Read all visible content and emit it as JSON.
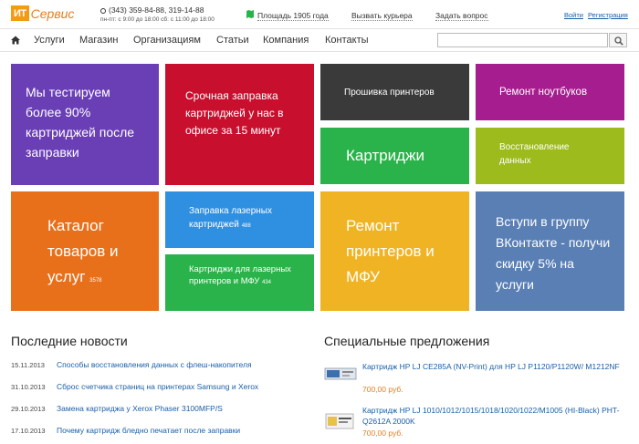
{
  "header": {
    "logo_box": "ИТ",
    "logo_text": "Сервис",
    "phone": "(343) 359-84-88, 319-14-88",
    "hours": "пн-пт: с 9:00 до 18:00   сб: с 11:00 до 18:00",
    "address": "Площадь 1905 года",
    "courier": "Вызвать курьера",
    "question": "Задать вопрос",
    "login": "Войти",
    "register": "Регистрация"
  },
  "nav": {
    "items": [
      "Услуги",
      "Магазин",
      "Организациям",
      "Статьи",
      "Компания",
      "Контакты"
    ],
    "search_placeholder": ""
  },
  "tiles": [
    {
      "text": "Мы тестируем более 90% картриджей после заправки",
      "color": "#6a3fb5"
    },
    {
      "text": "Срочная заправка картриджей у нас в офисе за 15 минут",
      "color": "#c8102e"
    },
    {
      "text": "Прошивка принтеров",
      "color": "#3a3a3a"
    },
    {
      "text": "Ремонт ноутбуков",
      "color": "#a51d8e"
    },
    {
      "text": "Картриджи",
      "color": "#2ab34a"
    },
    {
      "text": "Восстановление данных",
      "color": "#9dbb1c"
    },
    {
      "text": "Каталог товаров и услуг",
      "count": "3578",
      "color": "#e9701a"
    },
    {
      "text": "Заправка лазерных картриджей",
      "count": "488",
      "color": "#2f8fe0"
    },
    {
      "text": "Картриджи для лазерных принтеров и МФУ",
      "count": "434",
      "color": "#2ab34a"
    },
    {
      "text": "Ремонт принтеров и МФУ",
      "color": "#f0b323"
    },
    {
      "text": "Вступи в группу ВКонтакте - получи скидку 5% на услуги",
      "color": "#5a7fb5"
    }
  ],
  "news": {
    "title": "Последние новости",
    "items": [
      {
        "date": "15.11.2013",
        "text": "Способы восстановления данных с флеш-накопителя"
      },
      {
        "date": "31.10.2013",
        "text": "Сброс счетчика страниц на принтерах Samsung и Xerox"
      },
      {
        "date": "29.10.2013",
        "text": "Замена картриджа у Xerox Phaser 3100MFP/S"
      },
      {
        "date": "17.10.2013",
        "text": "Почему картридж бледно печатает после заправки"
      }
    ]
  },
  "offers": {
    "title": "Специальные предложения",
    "items": [
      {
        "title": "Картридж HP LJ CE285A (NV-Print) для HP LJ P1120/P1120W/ M1212NF",
        "price": "700,00 руб."
      },
      {
        "title": "Картридж HP LJ 1010/1012/1015/1018/1020/1022/M1005 (HI-Black) PHT-Q2612A 2000K",
        "price": "700,00 руб."
      }
    ]
  }
}
